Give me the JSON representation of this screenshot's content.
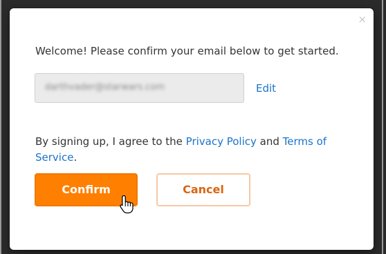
{
  "dialog": {
    "close_label": "×",
    "welcome_text": "Welcome! Please confirm your email below to get started.",
    "email_value": "darthvader@starwars.com",
    "edit_label": "Edit",
    "terms": {
      "prefix": "By signing up, I agree to the ",
      "privacy_label": "Privacy Policy",
      "middle": " and ",
      "terms_label": "Terms of Service",
      "suffix": "."
    },
    "confirm_label": "Confirm",
    "cancel_label": "Cancel"
  },
  "colors": {
    "accent": "#ff7f00",
    "link": "#1a73c9",
    "cancel_text": "#d86512"
  },
  "icons": {
    "close": "close-icon",
    "cursor": "hand-pointer-cursor-icon"
  }
}
